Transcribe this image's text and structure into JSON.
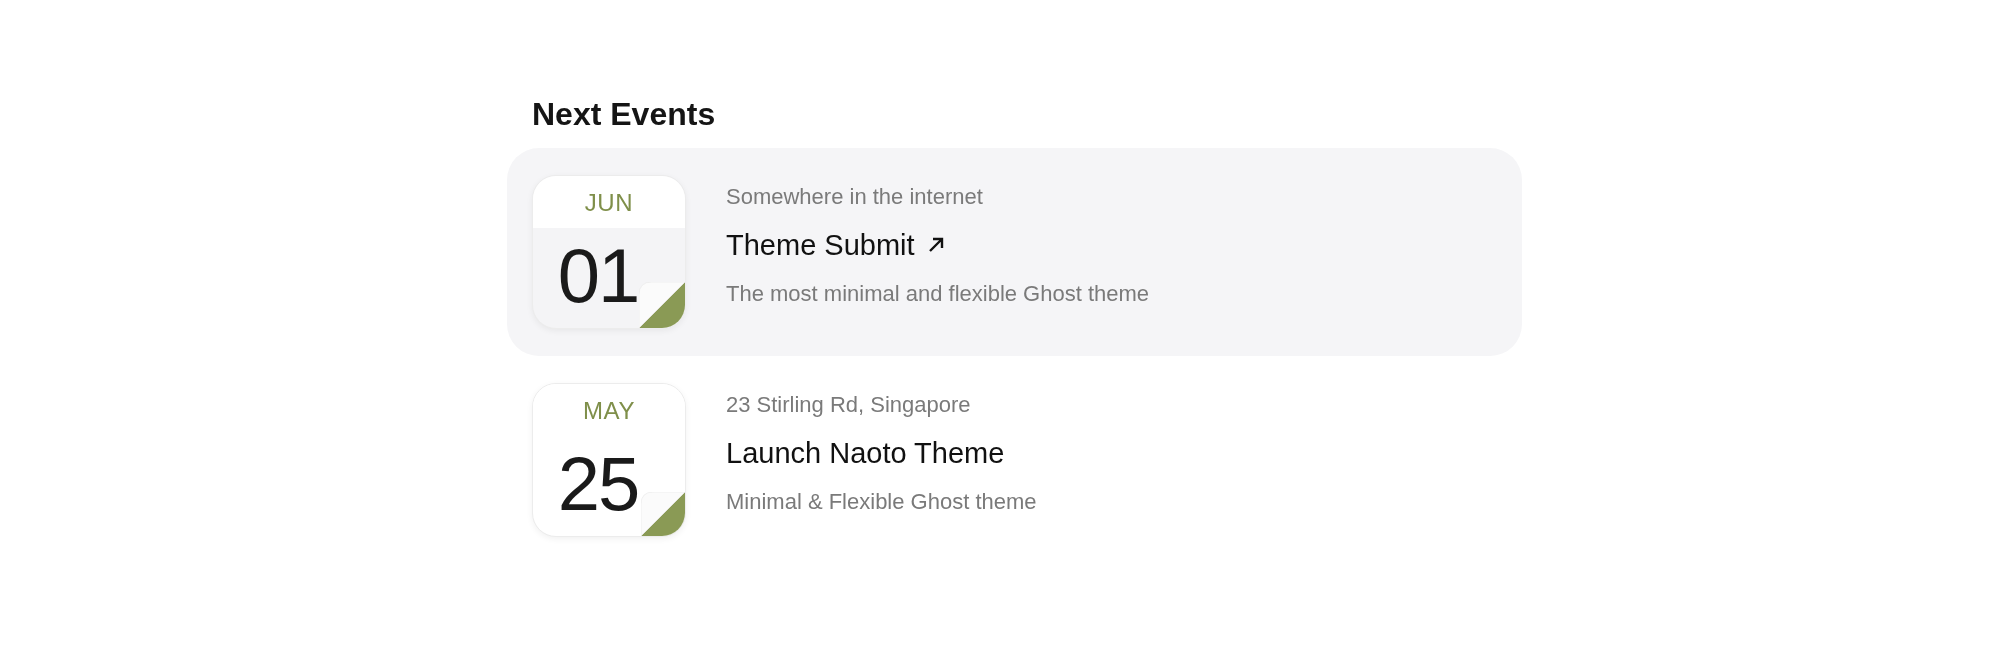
{
  "heading": "Next Events",
  "events": [
    {
      "month": "JUN",
      "day": "01",
      "location": "Somewhere in the internet",
      "title": "Theme Submit",
      "external_link": true,
      "description": "The most minimal and flexible Ghost theme",
      "selected": true
    },
    {
      "month": "MAY",
      "day": "25",
      "location": "23 Stirling Rd, Singapore",
      "title": "Launch Naoto Theme",
      "external_link": false,
      "description": "Minimal & Flexible Ghost theme",
      "selected": false
    }
  ]
}
